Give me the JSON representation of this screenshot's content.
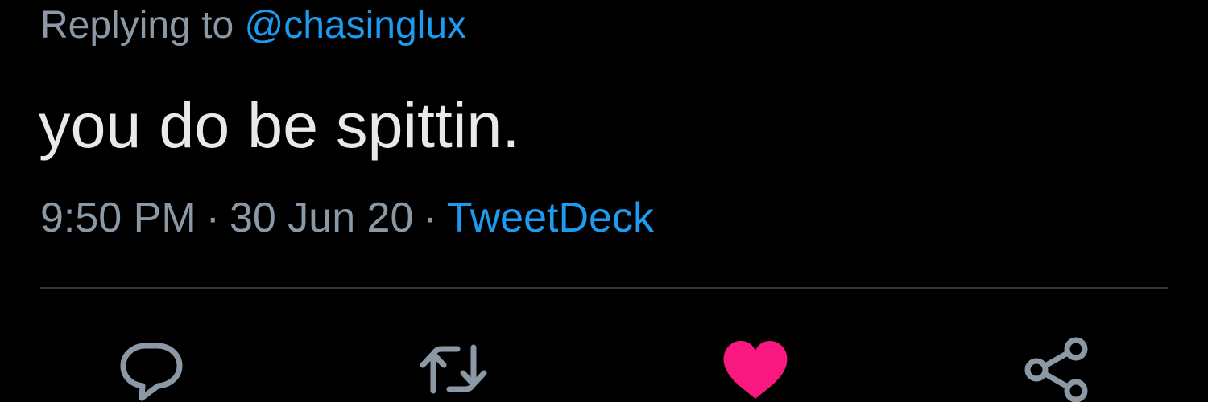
{
  "reply": {
    "prefix": "Replying to ",
    "handle": "@chasinglux"
  },
  "tweet": {
    "text": "you do be spittin.",
    "time": "9:50 PM",
    "date": "30 Jun 20",
    "separator": "·",
    "source": "TweetDeck"
  },
  "actions": {
    "reply_icon": "comment-icon",
    "retweet_icon": "retweet-icon",
    "like_icon": "heart-icon",
    "share_icon": "share-icon",
    "like_active": true
  },
  "colors": {
    "background": "#000000",
    "text": "#e7e9ea",
    "muted": "#8b98a5",
    "accent": "#1d9bf0",
    "like": "#f91880",
    "divider": "#2f3336"
  }
}
